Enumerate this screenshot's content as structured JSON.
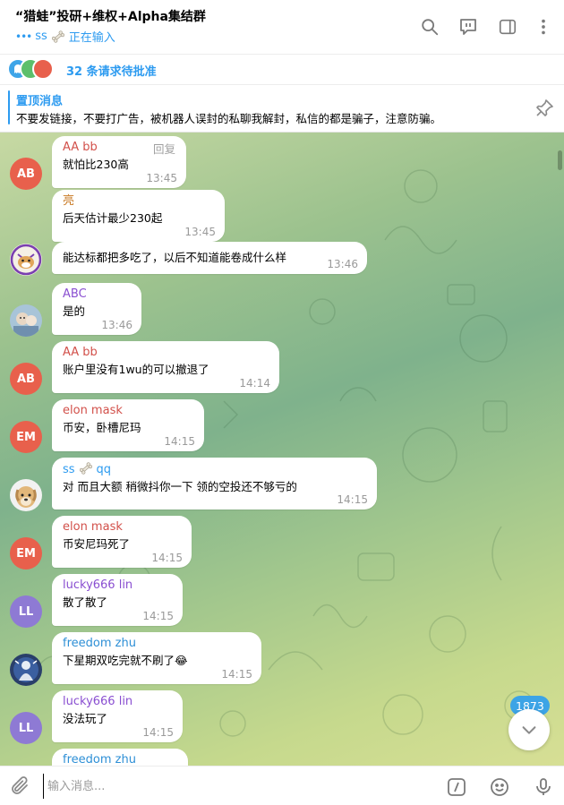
{
  "header": {
    "title": "“猎蛙”投研+维权+Alpha集结群",
    "status_user": "ss",
    "status_text": "正在输入",
    "icons": [
      "search-icon",
      "topics-icon",
      "sidebar-toggle-icon",
      "more-vertical-icon"
    ]
  },
  "join_requests": {
    "text": "32 条请求待批准"
  },
  "pinned": {
    "title": "置顶消息",
    "text": "不要发链接，不要打广告，被机器人误封的私聊我解封，私信的都是骗子，注意防骗。"
  },
  "messages": [
    {
      "sender": "AA bb",
      "sender_color": "#d2504a",
      "text": "就怕比230高",
      "time": "13:45",
      "avatar": "AB",
      "avatar_color": "#e8604c",
      "reply_label": "回复"
    },
    {
      "sender": "亮",
      "sender_color": "#c97a25",
      "text": "后天估计最少230起",
      "time": "13:45"
    },
    {
      "sender": "",
      "text": "能达标都把多吃了，以后不知道能卷成什么样",
      "time": "13:46"
    },
    {
      "sender": "ABC",
      "sender_color": "#8a4fd1",
      "text": "是的",
      "time": "13:46"
    },
    {
      "sender": "AA bb",
      "sender_color": "#d2504a",
      "text": "账户里没有1wu的可以撤退了",
      "time": "14:14",
      "avatar": "AB"
    },
    {
      "sender": "elon mask",
      "sender_color": "#d2504a",
      "text": "币安，卧槽尼玛",
      "time": "14:15",
      "avatar": "EM"
    },
    {
      "sender": "ss",
      "sender_suffix": "qq",
      "sender_color": "#2d9bf0",
      "text": "对 而且大额 稍微抖你一下 领的空投还不够亏的",
      "time": "14:15"
    },
    {
      "sender": "elon mask",
      "sender_color": "#d2504a",
      "text": "币安尼玛死了",
      "time": "14:15",
      "avatar": "EM"
    },
    {
      "sender": "lucky666 lin",
      "sender_color": "#8a4fd1",
      "text": "散了散了",
      "time": "14:15",
      "avatar": "LL"
    },
    {
      "sender": "freedom zhu",
      "sender_color": "#2d8fd6",
      "text": "下星期双吃完就不刷了😂",
      "time": "14:15"
    },
    {
      "sender": "lucky666 lin",
      "sender_color": "#8a4fd1",
      "text": "没法玩了",
      "time": "14:15",
      "avatar": "LL"
    },
    {
      "sender": "freedom zhu",
      "sender_color": "#2d8fd6",
      "text": "",
      "time": ""
    }
  ],
  "unread_badge": "1873",
  "composer": {
    "placeholder": "输入消息...",
    "icons": [
      "attach-icon",
      "commands-icon",
      "emoji-icon",
      "microphone-icon"
    ]
  }
}
